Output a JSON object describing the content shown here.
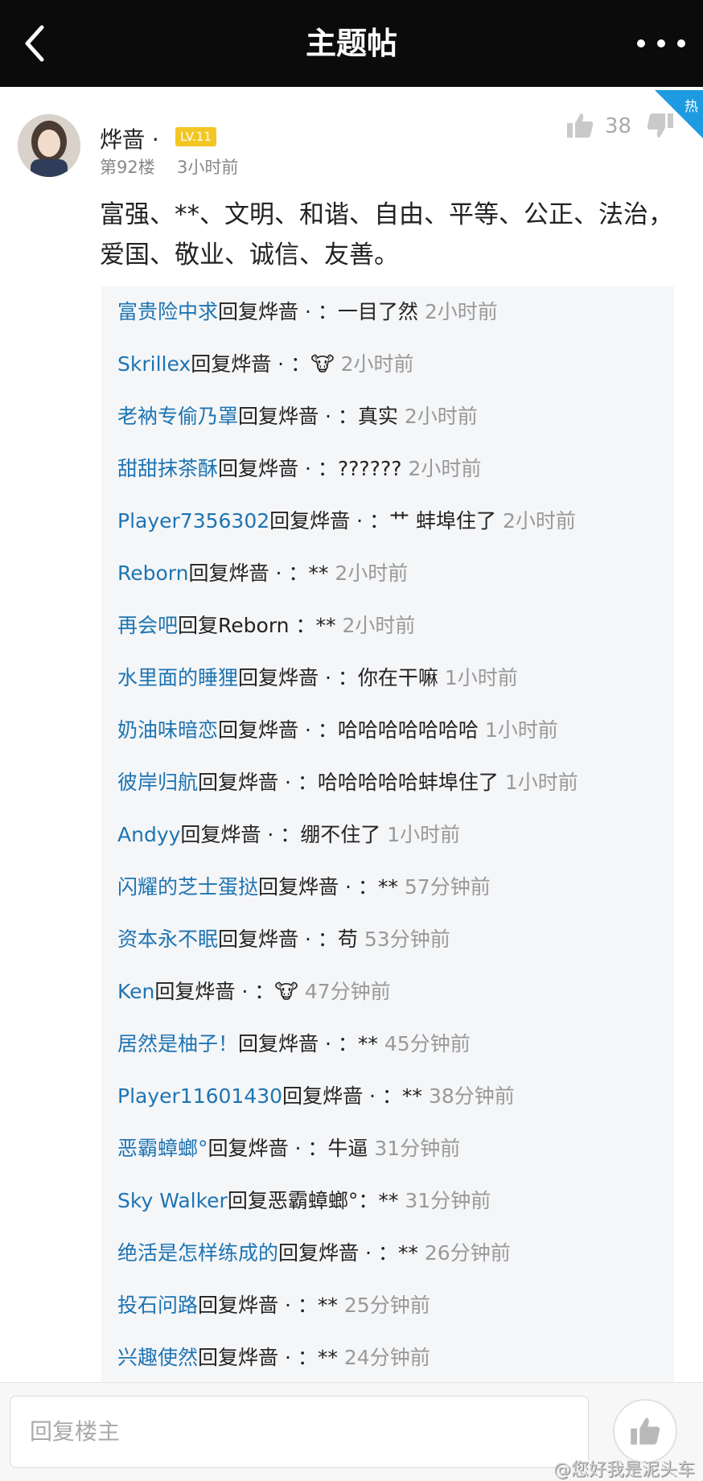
{
  "header": {
    "title": "主题帖"
  },
  "post": {
    "hot_badge": "热",
    "username": "烨啬 ·",
    "level": "LV.11",
    "floor": "第92楼",
    "time": "3小时前",
    "likes": "38",
    "content": "富强、**、文明、和谐、自由、平等、公正、法治，爱国、敬业、诚信、友善。"
  },
  "replies": [
    {
      "name": "富贵险中求",
      "verb": "回复",
      "target": "烨啬 · ",
      "text": "：一目了然",
      "time": "2小时前"
    },
    {
      "name": "Skrillex",
      "verb": "回复",
      "target": "烨啬 · ",
      "text": "：🐮",
      "time": "2小时前"
    },
    {
      "name": "老衲专偷乃罩",
      "verb": "回复",
      "target": "烨啬 · ",
      "text": "：真实",
      "time": "2小时前"
    },
    {
      "name": "甜甜抹茶酥",
      "verb": "回复",
      "target": "烨啬 · ",
      "text": "：??????",
      "time": "2小时前"
    },
    {
      "name": "Player7356302",
      "verb": "回复",
      "target": "烨啬 · ",
      "text": "：艹 蚌埠住了",
      "time": "2小时前"
    },
    {
      "name": "Reborn",
      "verb": "回复",
      "target": "烨啬 · ",
      "text": "：**",
      "time": "2小时前"
    },
    {
      "name": "再会吧",
      "verb": "回复",
      "target": "Reborn ",
      "text": "：**",
      "time": "2小时前"
    },
    {
      "name": "水里面的睡狸",
      "verb": "回复",
      "target": "烨啬 · ",
      "text": "：你在干嘛",
      "time": "1小时前"
    },
    {
      "name": "奶油味暗恋",
      "verb": "回复",
      "target": "烨啬 · ",
      "text": "：哈哈哈哈哈哈哈",
      "time": "1小时前"
    },
    {
      "name": "彼岸归航",
      "verb": "回复",
      "target": "烨啬 · ",
      "text": "：哈哈哈哈哈蚌埠住了",
      "time": "1小时前"
    },
    {
      "name": "Andyy",
      "verb": "回复",
      "target": "烨啬 · ",
      "text": "：绷不住了",
      "time": "1小时前"
    },
    {
      "name": "闪耀的芝士蛋挞",
      "verb": "回复",
      "target": "烨啬 · ",
      "text": "：**",
      "time": "57分钟前"
    },
    {
      "name": "资本永不眠",
      "verb": "回复",
      "target": "烨啬 · ",
      "text": "：苟",
      "time": "53分钟前"
    },
    {
      "name": "Ken",
      "verb": "回复",
      "target": "烨啬 · ",
      "text": "：🐮",
      "time": "47分钟前"
    },
    {
      "name": "居然是柚子！",
      "verb": "回复",
      "target": "烨啬 · ",
      "text": "：**",
      "time": "45分钟前"
    },
    {
      "name": "Player11601430",
      "verb": "回复",
      "target": "烨啬 · ",
      "text": "：**",
      "time": "38分钟前"
    },
    {
      "name": "恶霸蟑螂°",
      "verb": "回复",
      "target": "烨啬 · ",
      "text": "：牛逼",
      "time": "31分钟前"
    },
    {
      "name": "Sky Walker",
      "verb": "回复",
      "target": "恶霸蟑螂°",
      "text": "：**",
      "time": "31分钟前"
    },
    {
      "name": "绝活是怎样练成的",
      "verb": "回复",
      "target": "烨啬 · ",
      "text": "：**",
      "time": "26分钟前"
    },
    {
      "name": "投石问路",
      "verb": "回复",
      "target": "烨啬 · ",
      "text": "：**",
      "time": "25分钟前"
    },
    {
      "name": "兴趣使然",
      "verb": "回复",
      "target": "烨啬 · ",
      "text": "：**",
      "time": "24分钟前"
    }
  ],
  "bottom": {
    "input_placeholder": "回复楼主",
    "watermark": "@您好我是泥头车"
  },
  "colors": {
    "header_bg": "#0b0b0b",
    "link": "#1d74b3",
    "hot": "#1e9be0",
    "level": "#f3c623"
  },
  "icons": [
    "back-icon",
    "more-icon",
    "thumbs-up-icon",
    "thumbs-down-icon"
  ]
}
